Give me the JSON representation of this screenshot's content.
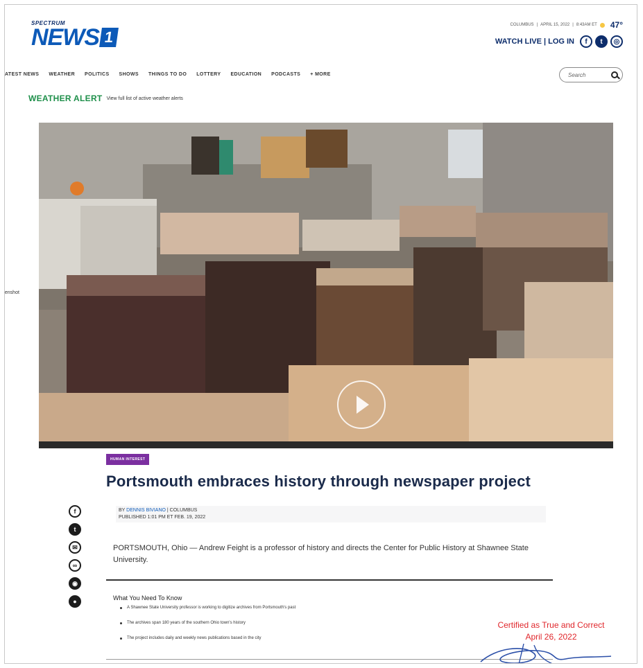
{
  "header": {
    "logo_small": "SPECTRUM",
    "logo_main": "NEWS",
    "logo_number": "1",
    "location": "COLUMBUS",
    "date": "APRIL 15, 2022",
    "time": "8:43AM ET",
    "temperature": "47°",
    "account_links": "WATCH LIVE | LOG IN"
  },
  "nav": {
    "items": [
      "ATEST NEWS",
      "WEATHER",
      "POLITICS",
      "SHOWS",
      "THINGS TO DO",
      "LOTTERY",
      "EDUCATION",
      "PODCASTS",
      "+ MORE"
    ],
    "search_placeholder": "Search"
  },
  "alert": {
    "title": "WEATHER ALERT",
    "link": "View full list of active weather alerts"
  },
  "hero": {
    "side_tag": "eenshot"
  },
  "article": {
    "category": "HUMAN INTEREST",
    "headline": "Portsmouth embraces history through newspaper project",
    "by_prefix": "BY",
    "author": "DENNIS BIVIANO",
    "author_location": " | COLUMBUS",
    "published": "PUBLISHED 1:01 PM ET FEB. 19, 2022",
    "lede": "PORTSMOUTH, Ohio — Andrew Feight is a professor of history and directs the Center for Public History at Shawnee State University.",
    "wynk_title": "What You Need To Know",
    "wynk_items": [
      "A Shawnee State University professor is working to digitize archives from Portsmouth's past",
      "The archives span 180 years of the southern Ohio town's history",
      "The project includes daily and weekly news publications based in the city"
    ]
  },
  "certification": {
    "line1": "Certified as True and Correct",
    "line2": "April 26,  2022"
  },
  "colors": {
    "brand_blue": "#0d5ab8",
    "navy": "#0d2d6b",
    "alert_green": "#1e8f4a",
    "badge_purple": "#7b2fa0",
    "cert_red": "#e0262b"
  }
}
